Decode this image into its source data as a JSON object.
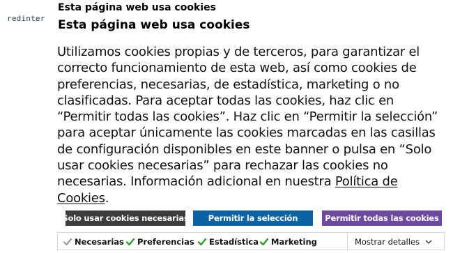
{
  "brand": {
    "logo_text": "redinter"
  },
  "dialog": {
    "top_label": "Esta página web usa cookies",
    "title": "Esta página web usa cookies",
    "body_text": "Utilizamos cookies propias y de terceros, para garantizar el correcto funcionamiento de esta web, así como cookies de preferencias, necesarias, de estadística, marketing o no clasificadas. Para aceptar todas las cookies, haz clic en “Permitir todas las cookies”. Haz clic en “Permitir la selección” para aceptar únicamente las cookies marcadas en las casillas de configuración disponibles en este banner o pulsa en “Solo usar cookies necesarias” para rechazar las cookies no necesarias. Información adicional en nuestra ",
    "policy_link": "Política de Cookies",
    "body_end": "."
  },
  "buttons": {
    "necessary_only": "Solo usar cookies necesarias",
    "allow_selection": "Permitir la selección",
    "allow_all": "Permitir todas las cookies"
  },
  "options": [
    {
      "label": "Necesarias",
      "checked": true,
      "disabled": true,
      "icon": "checkmark-icon"
    },
    {
      "label": "Preferencias",
      "checked": true,
      "disabled": false,
      "icon": "checkmark-icon"
    },
    {
      "label": "Estadística",
      "checked": true,
      "disabled": false,
      "icon": "checkmark-icon"
    },
    {
      "label": "Marketing",
      "checked": true,
      "disabled": false,
      "icon": "checkmark-icon"
    }
  ],
  "details": {
    "label": "Mostrar detalles",
    "icon": "chevron-down-icon"
  },
  "colors": {
    "btn_necessary": "#3c3c3c",
    "btn_selection": "#0b63a6",
    "btn_all": "#6d4aa0",
    "check_active": "#2e9e2e",
    "check_disabled": "#9a9a9a"
  }
}
